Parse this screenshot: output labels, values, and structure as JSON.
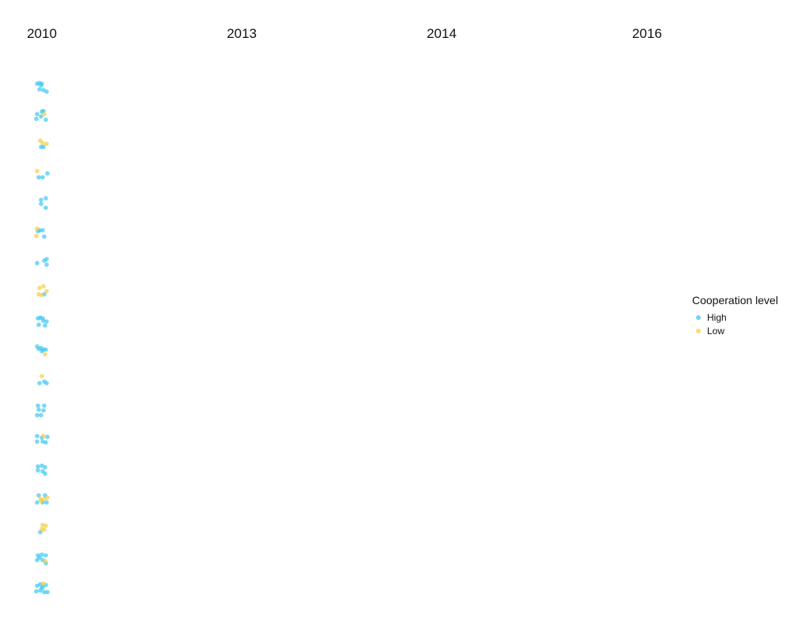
{
  "chart_data": {
    "type": "scatter",
    "title": "",
    "xlabel": "",
    "ylabel": "",
    "facets": [
      "2010",
      "2013",
      "2014",
      "2016"
    ],
    "rows": 18,
    "grid": false,
    "legend": {
      "title": "Cooperation level",
      "placement": "right",
      "entries": [
        {
          "name": "High",
          "color": "#3fc8f2"
        },
        {
          "name": "Low",
          "color": "#f7cd45"
        }
      ]
    },
    "series": [
      {
        "name": "High",
        "color": "#3fc8f2",
        "points": [
          {
            "facet": "2010",
            "row": 1,
            "dx": -6,
            "dy": -1
          },
          {
            "facet": "2010",
            "row": 1,
            "dx": -3,
            "dy": -2
          },
          {
            "facet": "2010",
            "row": 1,
            "dx": 0,
            "dy": -1
          },
          {
            "facet": "2010",
            "row": 1,
            "dx": -1,
            "dy": 1
          },
          {
            "facet": "2010",
            "row": 1,
            "dx": 2,
            "dy": 7
          },
          {
            "facet": "2010",
            "row": 1,
            "dx": 6,
            "dy": 9
          },
          {
            "facet": "2010",
            "row": 1,
            "dx": -3,
            "dy": 6
          },
          {
            "facet": "2010",
            "row": 2,
            "dx": -6,
            "dy": 0
          },
          {
            "facet": "2010",
            "row": 2,
            "dx": -7,
            "dy": 6
          },
          {
            "facet": "2010",
            "row": 2,
            "dx": 0,
            "dy": -3
          },
          {
            "facet": "2010",
            "row": 2,
            "dx": 2,
            "dy": -4
          },
          {
            "facet": "2010",
            "row": 2,
            "dx": 5,
            "dy": 7
          },
          {
            "facet": "2010",
            "row": 2,
            "dx": -1,
            "dy": 3
          },
          {
            "facet": "2010",
            "row": 3,
            "dx": -1,
            "dy": 4
          },
          {
            "facet": "2010",
            "row": 3,
            "dx": 2,
            "dy": 4
          },
          {
            "facet": "2010",
            "row": 4,
            "dx": -4,
            "dy": 5
          },
          {
            "facet": "2010",
            "row": 4,
            "dx": 1,
            "dy": 5
          },
          {
            "facet": "2010",
            "row": 4,
            "dx": 7,
            "dy": 0
          },
          {
            "facet": "2010",
            "row": 5,
            "dx": -1,
            "dy": -4
          },
          {
            "facet": "2010",
            "row": 5,
            "dx": 5,
            "dy": -6
          },
          {
            "facet": "2010",
            "row": 5,
            "dx": -1,
            "dy": 1
          },
          {
            "facet": "2010",
            "row": 5,
            "dx": 5,
            "dy": 6
          },
          {
            "facet": "2010",
            "row": 6,
            "dx": -3,
            "dy": -3
          },
          {
            "facet": "2010",
            "row": 6,
            "dx": 1,
            "dy": -3
          },
          {
            "facet": "2010",
            "row": 6,
            "dx": 3,
            "dy": 5
          },
          {
            "facet": "2010",
            "row": 6,
            "dx": -5,
            "dy": -2
          },
          {
            "facet": "2010",
            "row": 7,
            "dx": -6,
            "dy": 1
          },
          {
            "facet": "2010",
            "row": 7,
            "dx": 3,
            "dy": -2
          },
          {
            "facet": "2010",
            "row": 7,
            "dx": 6,
            "dy": -4
          },
          {
            "facet": "2010",
            "row": 7,
            "dx": 6,
            "dy": 3
          },
          {
            "facet": "2010",
            "row": 8,
            "dx": 3,
            "dy": 3
          },
          {
            "facet": "2010",
            "row": 9,
            "dx": -5,
            "dy": -4
          },
          {
            "facet": "2010",
            "row": 9,
            "dx": -2,
            "dy": -5
          },
          {
            "facet": "2010",
            "row": 9,
            "dx": 1,
            "dy": -4
          },
          {
            "facet": "2010",
            "row": 9,
            "dx": -4,
            "dy": 4
          },
          {
            "facet": "2010",
            "row": 9,
            "dx": 4,
            "dy": 5
          },
          {
            "facet": "2010",
            "row": 9,
            "dx": 6,
            "dy": 0
          },
          {
            "facet": "2010",
            "row": 9,
            "dx": 2,
            "dy": -1
          },
          {
            "facet": "2010",
            "row": 10,
            "dx": -6,
            "dy": -6
          },
          {
            "facet": "2010",
            "row": 10,
            "dx": -4,
            "dy": -3
          },
          {
            "facet": "2010",
            "row": 10,
            "dx": -1,
            "dy": -4
          },
          {
            "facet": "2010",
            "row": 10,
            "dx": 2,
            "dy": -2
          },
          {
            "facet": "2010",
            "row": 10,
            "dx": 5,
            "dy": -2
          },
          {
            "facet": "2010",
            "row": 10,
            "dx": 0,
            "dy": 0
          },
          {
            "facet": "2010",
            "row": 11,
            "dx": -3,
            "dy": 3
          },
          {
            "facet": "2010",
            "row": 11,
            "dx": 3,
            "dy": 1
          },
          {
            "facet": "2010",
            "row": 11,
            "dx": 6,
            "dy": 3
          },
          {
            "facet": "2010",
            "row": 12,
            "dx": -5,
            "dy": -6
          },
          {
            "facet": "2010",
            "row": 12,
            "dx": 3,
            "dy": -6
          },
          {
            "facet": "2010",
            "row": 12,
            "dx": -4,
            "dy": -1
          },
          {
            "facet": "2010",
            "row": 12,
            "dx": 2,
            "dy": 0
          },
          {
            "facet": "2010",
            "row": 12,
            "dx": -6,
            "dy": 6
          },
          {
            "facet": "2010",
            "row": 12,
            "dx": -1,
            "dy": 6
          },
          {
            "facet": "2010",
            "row": 13,
            "dx": -6,
            "dy": -5
          },
          {
            "facet": "2010",
            "row": 13,
            "dx": 0,
            "dy": -3
          },
          {
            "facet": "2010",
            "row": 13,
            "dx": 7,
            "dy": -4
          },
          {
            "facet": "2010",
            "row": 13,
            "dx": -6,
            "dy": 2
          },
          {
            "facet": "2010",
            "row": 13,
            "dx": 1,
            "dy": 2
          },
          {
            "facet": "2010",
            "row": 13,
            "dx": 5,
            "dy": 3
          },
          {
            "facet": "2010",
            "row": 14,
            "dx": -5,
            "dy": -4
          },
          {
            "facet": "2010",
            "row": 14,
            "dx": 0,
            "dy": -5
          },
          {
            "facet": "2010",
            "row": 14,
            "dx": 4,
            "dy": -3
          },
          {
            "facet": "2010",
            "row": 14,
            "dx": -5,
            "dy": 1
          },
          {
            "facet": "2010",
            "row": 14,
            "dx": 1,
            "dy": 2
          },
          {
            "facet": "2010",
            "row": 14,
            "dx": 4,
            "dy": 5
          },
          {
            "facet": "2010",
            "row": 15,
            "dx": -4,
            "dy": -5
          },
          {
            "facet": "2010",
            "row": 15,
            "dx": 4,
            "dy": -5
          },
          {
            "facet": "2010",
            "row": 15,
            "dx": -6,
            "dy": 4
          },
          {
            "facet": "2010",
            "row": 15,
            "dx": 1,
            "dy": 4
          },
          {
            "facet": "2010",
            "row": 15,
            "dx": 6,
            "dy": 4
          },
          {
            "facet": "2010",
            "row": 16,
            "dx": -2,
            "dy": 4
          },
          {
            "facet": "2010",
            "row": 17,
            "dx": -5,
            "dy": -4
          },
          {
            "facet": "2010",
            "row": 17,
            "dx": 0,
            "dy": -5
          },
          {
            "facet": "2010",
            "row": 17,
            "dx": 5,
            "dy": -4
          },
          {
            "facet": "2010",
            "row": 17,
            "dx": -6,
            "dy": 2
          },
          {
            "facet": "2010",
            "row": 17,
            "dx": 1,
            "dy": 2
          },
          {
            "facet": "2010",
            "row": 17,
            "dx": 5,
            "dy": 6
          },
          {
            "facet": "2010",
            "row": 17,
            "dx": -3,
            "dy": -1
          },
          {
            "facet": "2010",
            "row": 18,
            "dx": -6,
            "dy": -3
          },
          {
            "facet": "2010",
            "row": 18,
            "dx": -2,
            "dy": -5
          },
          {
            "facet": "2010",
            "row": 18,
            "dx": 1,
            "dy": -2
          },
          {
            "facet": "2010",
            "row": 18,
            "dx": 5,
            "dy": -4
          },
          {
            "facet": "2010",
            "row": 18,
            "dx": -7,
            "dy": 4
          },
          {
            "facet": "2010",
            "row": 18,
            "dx": -2,
            "dy": 3
          },
          {
            "facet": "2010",
            "row": 18,
            "dx": 3,
            "dy": 5
          },
          {
            "facet": "2010",
            "row": 18,
            "dx": 7,
            "dy": 5
          },
          {
            "facet": "2010",
            "row": 18,
            "dx": 0,
            "dy": 0
          }
        ]
      },
      {
        "name": "Low",
        "color": "#f7cd45",
        "points": [
          {
            "facet": "2010",
            "row": 2,
            "dx": 3,
            "dy": 0
          },
          {
            "facet": "2010",
            "row": 3,
            "dx": -2,
            "dy": -4
          },
          {
            "facet": "2010",
            "row": 3,
            "dx": 1,
            "dy": -1
          },
          {
            "facet": "2010",
            "row": 3,
            "dx": 6,
            "dy": 0
          },
          {
            "facet": "2010",
            "row": 4,
            "dx": -6,
            "dy": -3
          },
          {
            "facet": "2010",
            "row": 6,
            "dx": -6,
            "dy": -5
          },
          {
            "facet": "2010",
            "row": 6,
            "dx": -7,
            "dy": 4
          },
          {
            "facet": "2010",
            "row": 8,
            "dx": -3,
            "dy": -5
          },
          {
            "facet": "2010",
            "row": 8,
            "dx": 2,
            "dy": -7
          },
          {
            "facet": "2010",
            "row": 8,
            "dx": 6,
            "dy": -1
          },
          {
            "facet": "2010",
            "row": 8,
            "dx": -4,
            "dy": 3
          },
          {
            "facet": "2010",
            "row": 8,
            "dx": 0,
            "dy": 4
          },
          {
            "facet": "2010",
            "row": 10,
            "dx": 4,
            "dy": 4
          },
          {
            "facet": "2010",
            "row": 11,
            "dx": 0,
            "dy": -6
          },
          {
            "facet": "2010",
            "row": 13,
            "dx": 2,
            "dy": -5
          },
          {
            "facet": "2010",
            "row": 15,
            "dx": -2,
            "dy": -1
          },
          {
            "facet": "2010",
            "row": 15,
            "dx": 3,
            "dy": 0
          },
          {
            "facet": "2010",
            "row": 15,
            "dx": 7,
            "dy": -2
          },
          {
            "facet": "2010",
            "row": 15,
            "dx": -1,
            "dy": 2
          },
          {
            "facet": "2010",
            "row": 16,
            "dx": 1,
            "dy": -5
          },
          {
            "facet": "2010",
            "row": 16,
            "dx": 5,
            "dy": -4
          },
          {
            "facet": "2010",
            "row": 16,
            "dx": 0,
            "dy": 0
          },
          {
            "facet": "2010",
            "row": 16,
            "dx": 3,
            "dy": 1
          },
          {
            "facet": "2010",
            "row": 17,
            "dx": 4,
            "dy": 3
          },
          {
            "facet": "2010",
            "row": 18,
            "dx": 2,
            "dy": -6
          }
        ]
      }
    ]
  }
}
